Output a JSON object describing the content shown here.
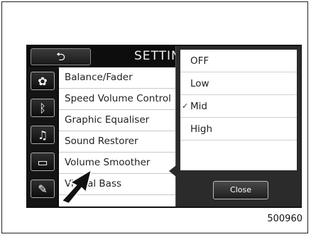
{
  "header": {
    "back_label": "⮌",
    "title": "SETTIN"
  },
  "sidebar": {
    "items": [
      {
        "icon": "gear-icon",
        "glyph": "✿"
      },
      {
        "icon": "bluetooth-icon",
        "glyph": "ᛒ"
      },
      {
        "icon": "music-note-icon",
        "glyph": "♫"
      },
      {
        "icon": "display-icon",
        "glyph": "▭"
      },
      {
        "icon": "wrench-icon",
        "glyph": "✎"
      }
    ]
  },
  "settings_list": {
    "items": [
      {
        "label": "Balance/Fader"
      },
      {
        "label": "Speed Volume Control"
      },
      {
        "label": "Graphic Equaliser"
      },
      {
        "label": "Sound Restorer"
      },
      {
        "label": "Volume Smoother"
      },
      {
        "label": "Virtual Bass"
      }
    ]
  },
  "popup": {
    "options": [
      {
        "label": "OFF",
        "checked": false
      },
      {
        "label": "Low",
        "checked": false
      },
      {
        "label": "Mid",
        "checked": true
      },
      {
        "label": "High",
        "checked": false
      }
    ],
    "close_label": "Close"
  },
  "figure_code": "500960"
}
